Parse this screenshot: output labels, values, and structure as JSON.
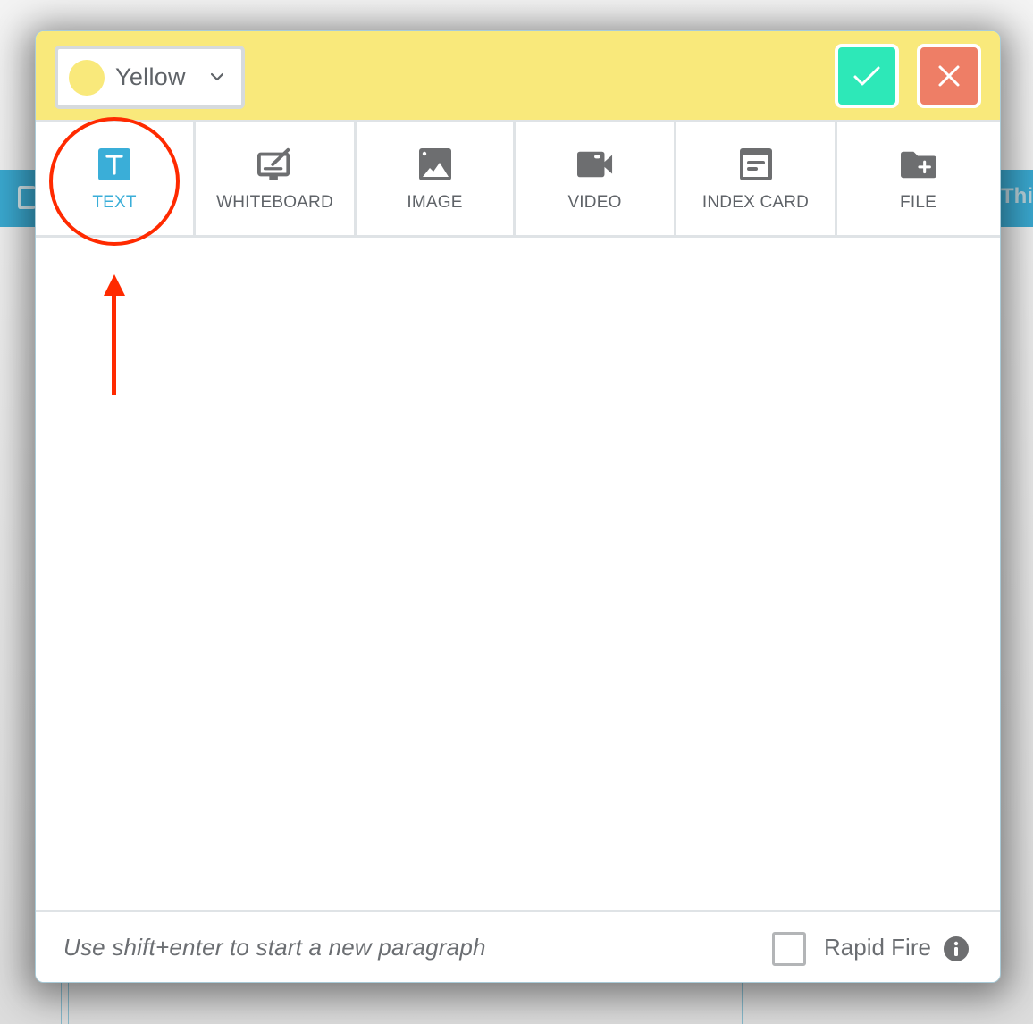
{
  "background": {
    "right_bar_text": "Thi"
  },
  "header": {
    "color_select": {
      "label": "Yellow",
      "swatch_color": "#f9e97b",
      "icon": "chevron-down-icon"
    },
    "confirm_button": {
      "icon": "check-icon",
      "color": "#2de8b8"
    },
    "cancel_button": {
      "icon": "close-icon",
      "color": "#ee7e66"
    }
  },
  "tabs": [
    {
      "id": "text",
      "label": "TEXT",
      "icon": "text-icon",
      "active": true
    },
    {
      "id": "whiteboard",
      "label": "WHITEBOARD",
      "icon": "whiteboard-icon",
      "active": false
    },
    {
      "id": "image",
      "label": "IMAGE",
      "icon": "image-icon",
      "active": false
    },
    {
      "id": "video",
      "label": "VIDEO",
      "icon": "video-camera-icon",
      "active": false
    },
    {
      "id": "index-card",
      "label": "INDEX CARD",
      "icon": "index-card-icon",
      "active": false
    },
    {
      "id": "file",
      "label": "FILE",
      "icon": "folder-plus-icon",
      "active": false
    }
  ],
  "footer": {
    "hint": "Use shift+enter to start a new paragraph",
    "rapid_fire": {
      "label": "Rapid Fire",
      "checked": false,
      "icon": "info-icon"
    }
  },
  "annotation": {
    "color": "#ff2a00",
    "target": "TEXT"
  }
}
